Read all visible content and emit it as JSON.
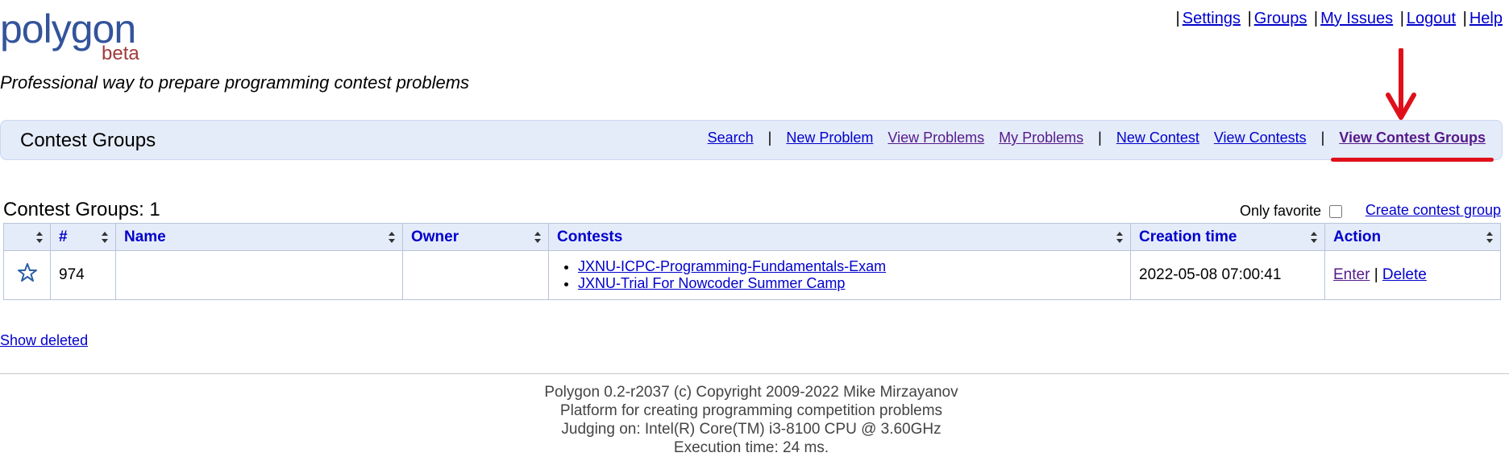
{
  "logo": {
    "word": "polygon",
    "beta": "beta"
  },
  "tagline": "Professional way to prepare programming contest problems",
  "top_links": [
    "Settings",
    "Groups",
    "My Issues",
    "Logout",
    "Help"
  ],
  "header": {
    "title": "Contest Groups",
    "nav": {
      "search": "Search",
      "new_problem": "New Problem",
      "view_problems": "View Problems",
      "my_problems": "My Problems",
      "new_contest": "New Contest",
      "view_contests": "View Contests",
      "view_contest_groups": "View Contest Groups"
    }
  },
  "section": {
    "heading": "Contest Groups: 1",
    "only_favorite": "Only favorite",
    "create": "Create contest group"
  },
  "table": {
    "columns": [
      "",
      "#",
      "Name",
      "Owner",
      "Contests",
      "Creation time",
      "Action"
    ],
    "rows": [
      {
        "id": "974",
        "name": "",
        "owner": "",
        "contests": [
          "JXNU-ICPC-Programming-Fundamentals-Exam",
          "JXNU-Trial For Nowcoder Summer Camp"
        ],
        "created": "2022-05-08 07:00:41",
        "actions": {
          "enter": "Enter",
          "sep": "|",
          "delete": "Delete"
        }
      }
    ]
  },
  "show_deleted": "Show deleted",
  "footer": [
    "Polygon 0.2-r2037 (c) Copyright 2009-2022 Mike Mirzayanov",
    "Platform for creating programming competition problems",
    "Judging on: Intel(R) Core(TM) i3-8100 CPU @ 3.60GHz",
    "Execution time: 24 ms."
  ],
  "colors": {
    "accent_red": "#e0101a",
    "bar_bg": "#e5ecf9",
    "link": "#0000cc"
  }
}
